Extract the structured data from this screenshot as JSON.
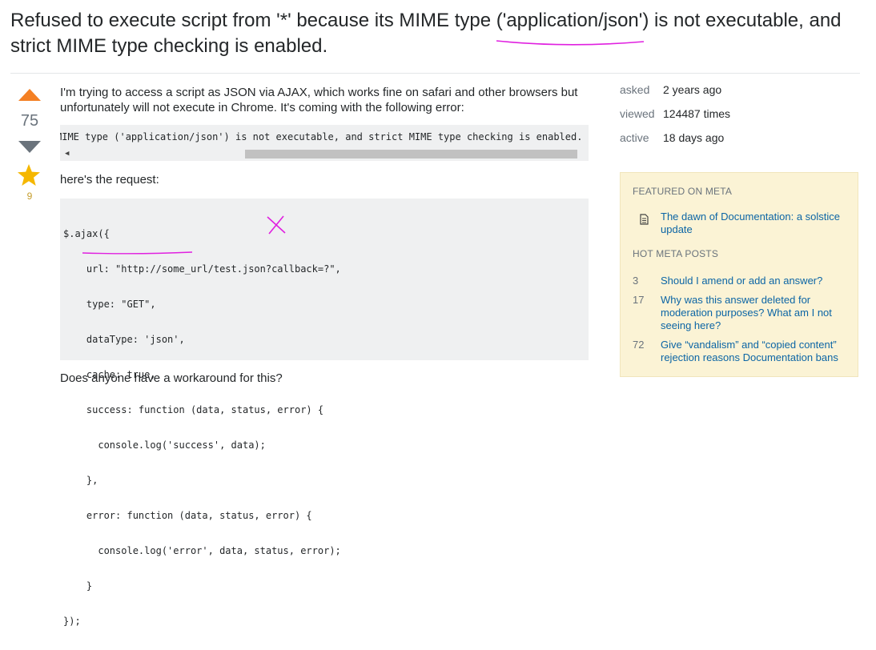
{
  "question": {
    "title": "Refused to execute script from '*' because its MIME type ('application/json') is not executable, and strict MIME type checking is enabled.",
    "votes": "75",
    "favorites": "9",
    "intro": "I'm trying to access a script as JSON via AJAX, which works fine on safari and other browsers but unfortunately will not execute in Chrome. It's coming with the following error:",
    "error_code": "MIME type ('application/json') is not executable, and strict MIME type checking is enabled.",
    "request_label": "here's the request:",
    "code_lines": [
      "$.ajax({",
      "    url: \"http://some_url/test.json?callback=?\",",
      "    type: \"GET\",",
      "    dataType: 'json',",
      "    cache: true,",
      "    success: function (data, status, error) {",
      "      console.log('success', data);",
      "    },",
      "    error: function (data, status, error) {",
      "      console.log('error', data, status, error);",
      "    }",
      "});"
    ],
    "closing": "Does anyone have a workaround for this?"
  },
  "stats": {
    "asked_label": "asked",
    "asked_value": "2 years ago",
    "viewed_label": "viewed",
    "viewed_value": "124487 times",
    "active_label": "active",
    "active_value": "18 days ago"
  },
  "sidebar": {
    "featured_heading": "FEATURED ON META",
    "featured_link": "The dawn of Documentation: a solstice update",
    "hot_heading": "HOT META POSTS",
    "hot_posts": [
      {
        "count": "3",
        "title": "Should I amend or add an answer?"
      },
      {
        "count": "17",
        "title": "Why was this answer deleted for moderation purposes? What am I not seeing here?"
      },
      {
        "count": "72",
        "title": "Give “vandalism” and “copied content” rejection reasons Documentation bans"
      }
    ]
  },
  "colors": {
    "upvote": "#f48024",
    "star": "#f5b700",
    "link": "#0c65a5",
    "annotation": "#e020e0"
  },
  "icons": {
    "upvote": "triangle-up-icon",
    "downvote": "triangle-down-icon",
    "favorite": "star-icon",
    "featured": "document-icon"
  }
}
